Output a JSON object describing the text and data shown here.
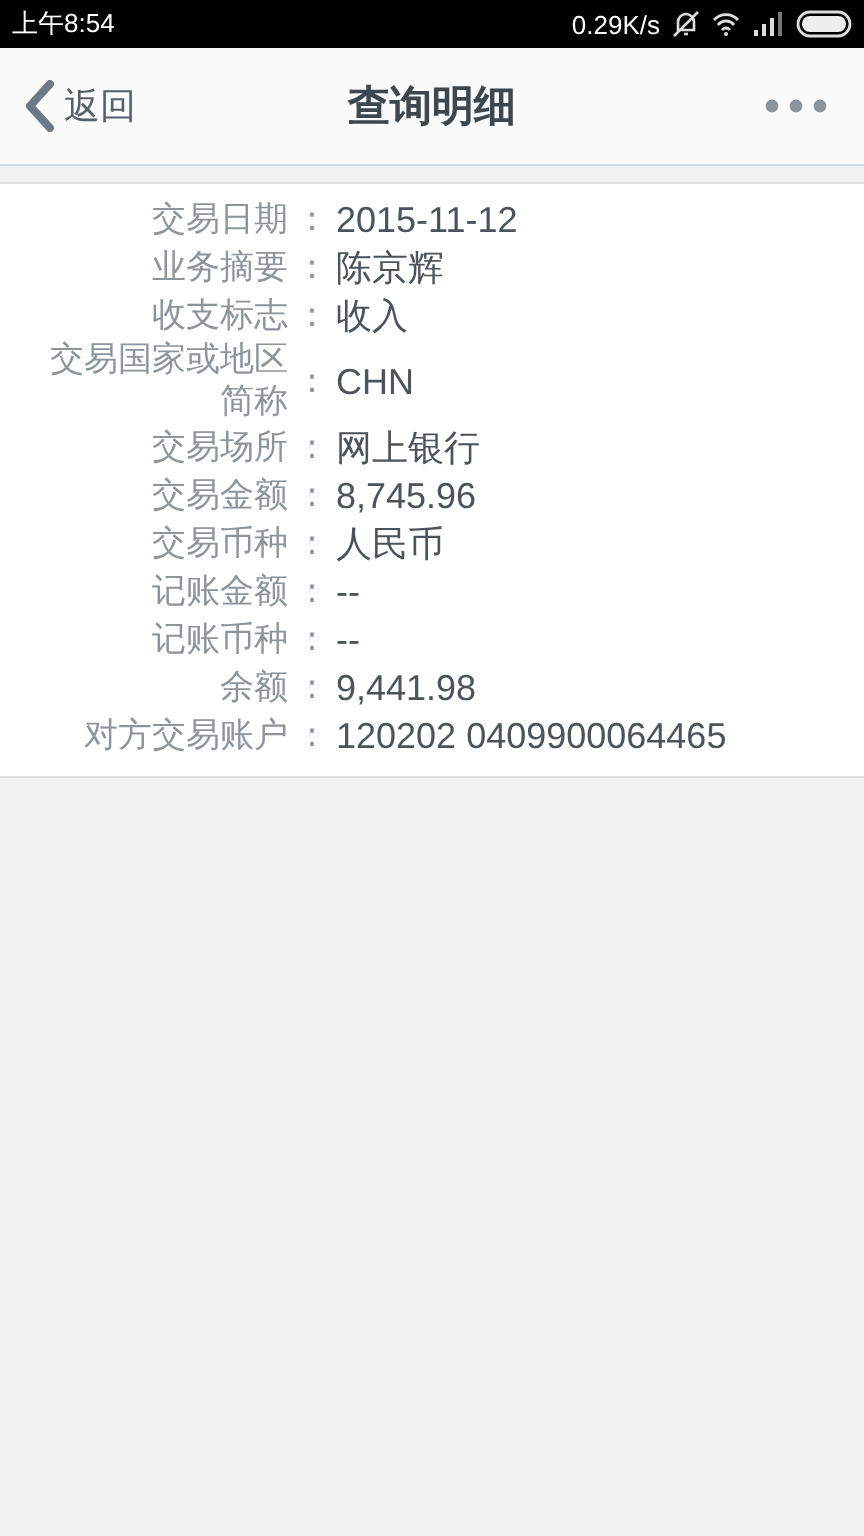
{
  "status_bar": {
    "time": "上午8:54",
    "speed": "0.29K/s"
  },
  "nav": {
    "back": "返回",
    "title": "查询明细"
  },
  "details": [
    {
      "label": "交易日期",
      "separator": ":",
      "value": "2015-11-12"
    },
    {
      "label": "业务摘要",
      "separator": ":",
      "value": "陈京辉"
    },
    {
      "label": "收支标志",
      "separator": ":",
      "value": "收入"
    },
    {
      "label": "交易国家或地区简称",
      "separator": ":",
      "value": "CHN"
    },
    {
      "label": "交易场所",
      "separator": ":",
      "value": "网上银行"
    },
    {
      "label": "交易金额",
      "separator": ":",
      "value": "8,745.96"
    },
    {
      "label": "交易币种",
      "separator": ":",
      "value": "人民币"
    },
    {
      "label": "记账金额",
      "separator": ":",
      "value": "--"
    },
    {
      "label": "记账币种",
      "separator": ":",
      "value": "--"
    },
    {
      "label": "余额",
      "separator": ":",
      "value": "9,441.98"
    },
    {
      "label": "对方交易账户",
      "separator": ":",
      "value": "120202 0409900064465"
    }
  ]
}
